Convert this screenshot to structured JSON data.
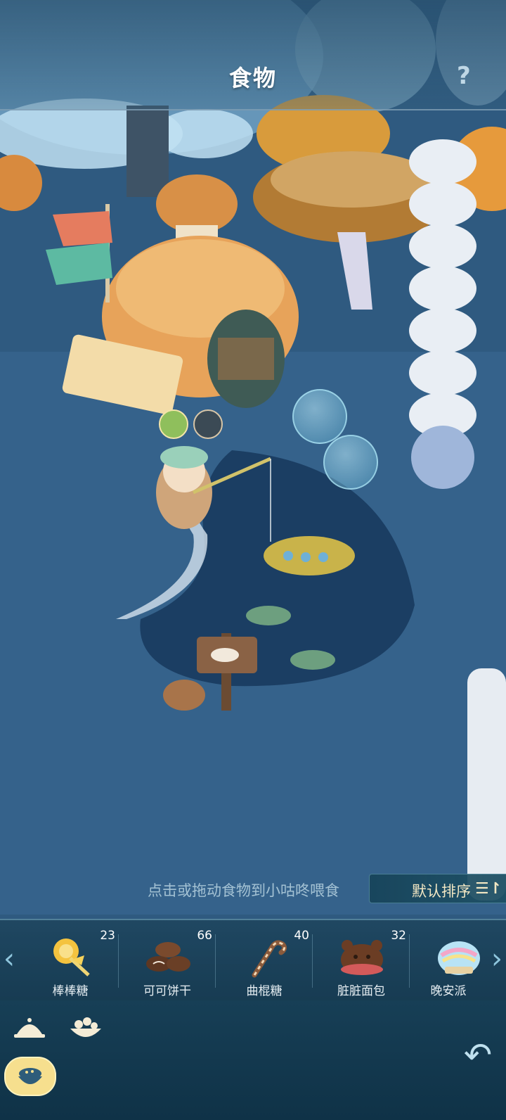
{
  "header": {
    "title": "食物",
    "help_icon": "question-mark-icon"
  },
  "hint_text": "点击或拖动食物到小咕咚喂食",
  "sort_button": {
    "label": "默认排序",
    "icon": "sort-icon"
  },
  "food_items": [
    {
      "name": "棒棒糖",
      "count": "23"
    },
    {
      "name": "可可饼干",
      "count": "66"
    },
    {
      "name": "曲棍糖",
      "count": "40"
    },
    {
      "name": "脏脏面包",
      "count": "32"
    },
    {
      "name": "晚安派",
      "count": ""
    }
  ],
  "colors": {
    "accent_gold": "#f6df8e",
    "shelf_bg": "#1e465f",
    "water": "#1b3e63"
  }
}
